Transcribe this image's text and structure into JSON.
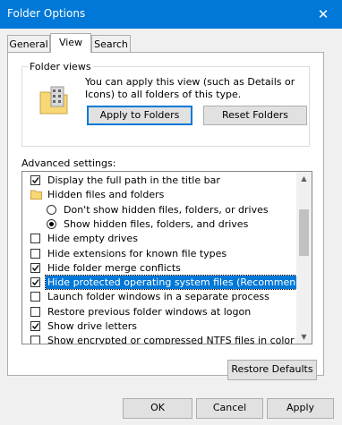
{
  "window": {
    "title": "Folder Options",
    "close_glyph": "✕"
  },
  "tabs": [
    {
      "label": "General"
    },
    {
      "label": "View"
    },
    {
      "label": "Search"
    }
  ],
  "folder_views": {
    "legend": "Folder views",
    "description": "You can apply this view (such as Details or Icons) to all folders of this type.",
    "apply_label": "Apply to Folders",
    "reset_label": "Reset Folders"
  },
  "advanced": {
    "label": "Advanced settings:",
    "items": [
      {
        "text": "Display the full path in the title bar",
        "control": "checkbox",
        "checked": true
      },
      {
        "text": "Hidden files and folders",
        "control": "folder"
      },
      {
        "text": "Don't show hidden files, folders, or drives",
        "control": "radio",
        "checked": false
      },
      {
        "text": "Show hidden files, folders, and drives",
        "control": "radio",
        "checked": true
      },
      {
        "text": "Hide empty drives",
        "control": "checkbox",
        "checked": false
      },
      {
        "text": "Hide extensions for known file types",
        "control": "checkbox",
        "checked": false
      },
      {
        "text": "Hide folder merge conflicts",
        "control": "checkbox",
        "checked": true
      },
      {
        "text": "Hide protected operating system files (Recommended)",
        "control": "checkbox",
        "checked": true,
        "selected": true
      },
      {
        "text": "Launch folder windows in a separate process",
        "control": "checkbox",
        "checked": false
      },
      {
        "text": "Restore previous folder windows at logon",
        "control": "checkbox",
        "checked": false
      },
      {
        "text": "Show drive letters",
        "control": "checkbox",
        "checked": true
      },
      {
        "text": "Show encrypted or compressed NTFS files in color",
        "control": "checkbox",
        "checked": false
      }
    ],
    "scroll_up": "▲",
    "scroll_down": "▼",
    "restore_defaults_label": "Restore Defaults"
  },
  "footer": {
    "ok_label": "OK",
    "cancel_label": "Cancel",
    "apply_label": "Apply"
  },
  "colors": {
    "accent": "#0078d7"
  }
}
